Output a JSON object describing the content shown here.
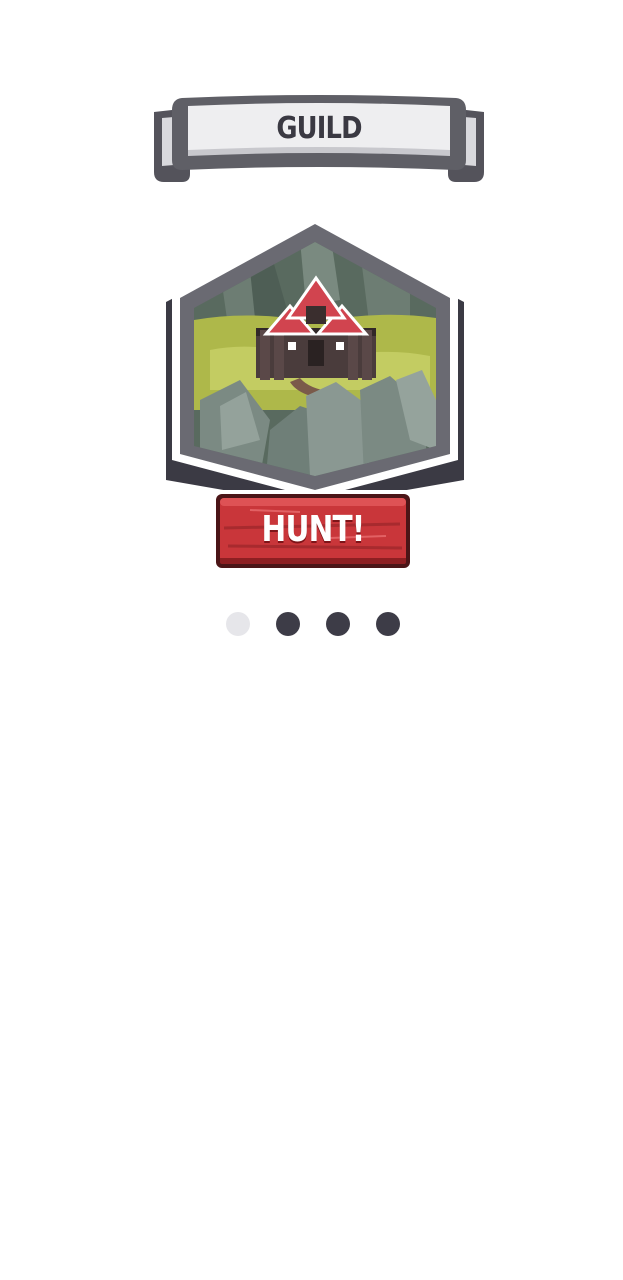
{
  "header": {
    "title": "GUILD"
  },
  "location": {
    "icon": "guild-hall-icon",
    "state": "locked-greyed"
  },
  "action": {
    "hunt_label": "HUNT!"
  },
  "pager": {
    "total": 4,
    "active_index": 0
  },
  "colors": {
    "background": "#ffffff",
    "banner_fill": "#eeeef0",
    "banner_outline": "#5f5f66",
    "hunt_button": "#c9363a",
    "hunt_button_dark": "#8d1f22",
    "dot_active": "#e6e6ea",
    "dot_inactive": "#3d3c47"
  }
}
